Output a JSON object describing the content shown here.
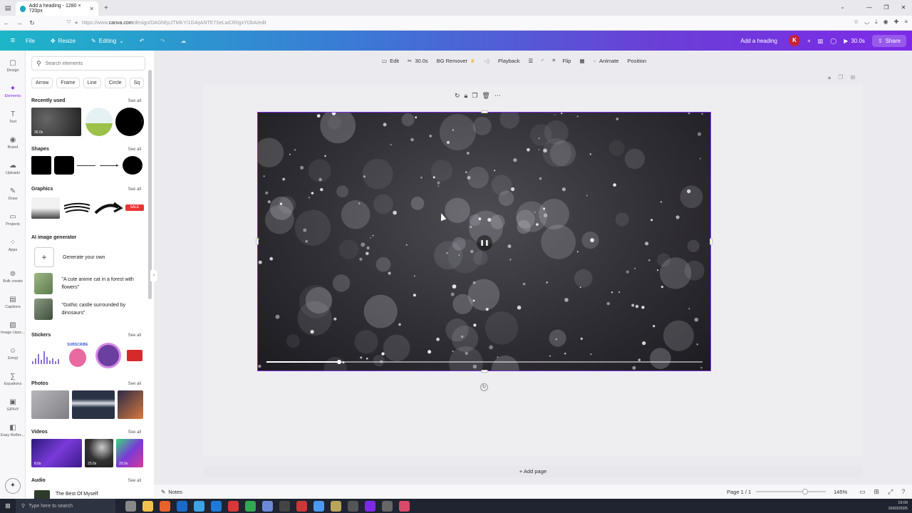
{
  "browser": {
    "tab_title": "Add a heading - 1280 × 720px",
    "url_prefix": "https://www.",
    "url_host": "canva.com",
    "url_path": "/design/DAGhEpJTMKY/1G4qANTE7SeLwCR0gxYDbA/edit"
  },
  "header": {
    "file": "File",
    "resize": "Resize",
    "editing": "Editing",
    "title": "Add a heading",
    "avatar_initial": "K",
    "duration": "30.0s",
    "share": "Share",
    "colors": {
      "avatar": "#c8213a",
      "accent": "#7d2ae8"
    }
  },
  "rail": [
    {
      "label": "Design",
      "icon": "design-icon",
      "glyph": "▢"
    },
    {
      "label": "Elements",
      "icon": "elements-icon",
      "glyph": "✦",
      "active": true
    },
    {
      "label": "Text",
      "icon": "text-icon",
      "glyph": "T"
    },
    {
      "label": "Brand",
      "icon": "brand-icon",
      "glyph": "◉"
    },
    {
      "label": "Uploads",
      "icon": "uploads-icon",
      "glyph": "☁"
    },
    {
      "label": "Draw",
      "icon": "draw-icon",
      "glyph": "✎"
    },
    {
      "label": "Projects",
      "icon": "projects-icon",
      "glyph": "▭"
    },
    {
      "label": "Apps",
      "icon": "apps-icon",
      "glyph": "⁘"
    },
    {
      "label": "Bulk create",
      "icon": "bulk-create-icon",
      "glyph": "⊚"
    },
    {
      "label": "Captions",
      "icon": "captions-icon",
      "glyph": "▤"
    },
    {
      "label": "Image Upsc...",
      "icon": "image-upscaler-icon",
      "glyph": "▨"
    },
    {
      "label": "Emoji",
      "icon": "emoji-icon",
      "glyph": "☺"
    },
    {
      "label": "Equations",
      "icon": "equations-icon",
      "glyph": "∑"
    },
    {
      "label": "GIPHY",
      "icon": "giphy-icon",
      "glyph": "▣"
    },
    {
      "label": "Easy Reflec...",
      "icon": "easy-reflection-icon",
      "glyph": "◧"
    }
  ],
  "panel": {
    "search_placeholder": "Search elements",
    "chips": [
      "Arrow",
      "Frame",
      "Line",
      "Circle",
      "Sq"
    ],
    "see_all": "See all",
    "sections": {
      "recently_used": "Recently used",
      "shapes": "Shapes",
      "graphics": "Graphics",
      "ai_generator": "AI image generator",
      "stickers": "Stickers",
      "photos": "Photos",
      "videos": "Videos",
      "audio": "Audio"
    },
    "recent_badge": "30.0s",
    "graphic_sale": "SALE",
    "sticker_text": "SUBSCRIBE",
    "generate": "Generate your own",
    "prompt_1": "\"A cute anime cat in a forest with flowers\"",
    "prompt_2": "\"Gothic castle surrounded by dinosaurs\"",
    "video_badges": [
      "8.0s",
      "23.0s",
      "20.0s"
    ],
    "audio_title": "The Best Of Myself"
  },
  "toolbar": {
    "edit": "Edit",
    "duration": "30.0s",
    "bg_remover": "BG Remover",
    "playback": "Playback",
    "flip": "Flip",
    "animate": "Animate",
    "position": "Position"
  },
  "video": {
    "progress": 0.166
  },
  "footer": {
    "notes": "Notes",
    "add_page": "+ Add page",
    "page_info": "Page 1 / 1",
    "zoom": "145%",
    "zoom_fraction": 0.66
  },
  "taskbar": {
    "search_placeholder": "Type here to search",
    "time": "19:09",
    "date": "16/03/2025"
  }
}
